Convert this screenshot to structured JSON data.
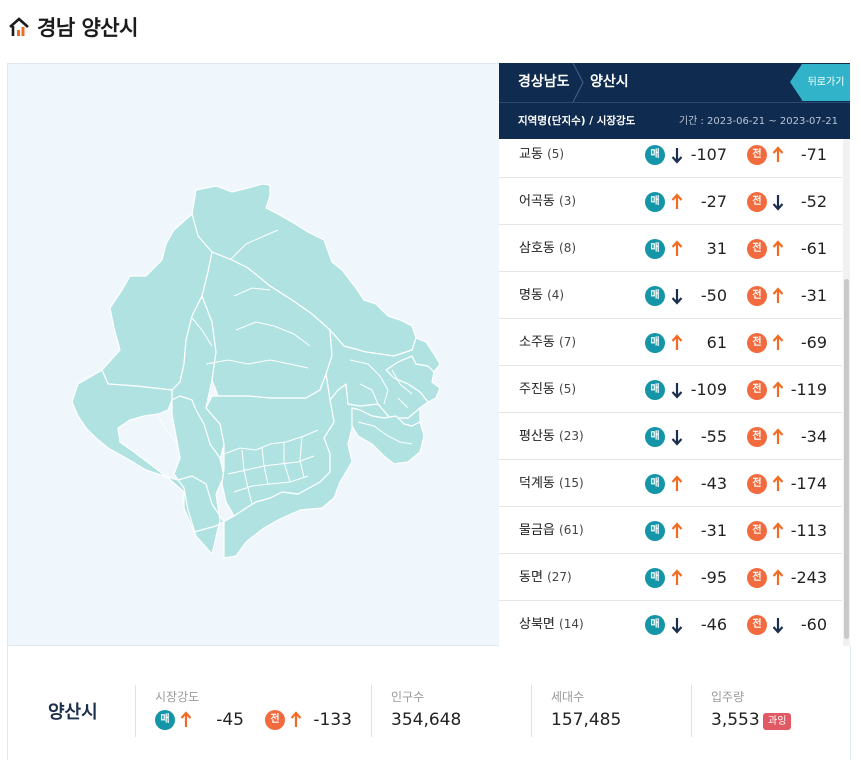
{
  "page": {
    "title": "경남 양산시"
  },
  "panel": {
    "breadcrumb": [
      "경상남도",
      "양산시"
    ],
    "back_label": "뒤로가기",
    "sub_left": "지역명(단지수) / 시장강도",
    "sub_right": "기간 : 2023-06-21 ~ 2023-07-21"
  },
  "badges": {
    "maemae": "매",
    "jeonse": "전"
  },
  "colors": {
    "up": "#f26b22",
    "down": "#1c2f4f",
    "maemae": "#1595a8",
    "jeonse": "#f26b3f",
    "map_fill": "#b0e2e2"
  },
  "rows": [
    {
      "name": "교동",
      "count": "(5)",
      "maemae_dir": "down",
      "maemae": "-107",
      "jeonse_dir": "up",
      "jeonse": "-71"
    },
    {
      "name": "어곡동",
      "count": "(3)",
      "maemae_dir": "up",
      "maemae": "-27",
      "jeonse_dir": "down",
      "jeonse": "-52"
    },
    {
      "name": "삼호동",
      "count": "(8)",
      "maemae_dir": "up",
      "maemae": "31",
      "jeonse_dir": "up",
      "jeonse": "-61"
    },
    {
      "name": "명동",
      "count": "(4)",
      "maemae_dir": "down",
      "maemae": "-50",
      "jeonse_dir": "up",
      "jeonse": "-31"
    },
    {
      "name": "소주동",
      "count": "(7)",
      "maemae_dir": "up",
      "maemae": "61",
      "jeonse_dir": "up",
      "jeonse": "-69"
    },
    {
      "name": "주진동",
      "count": "(5)",
      "maemae_dir": "down",
      "maemae": "-109",
      "jeonse_dir": "up",
      "jeonse": "-119"
    },
    {
      "name": "평산동",
      "count": "(23)",
      "maemae_dir": "down",
      "maemae": "-55",
      "jeonse_dir": "up",
      "jeonse": "-34"
    },
    {
      "name": "덕계동",
      "count": "(15)",
      "maemae_dir": "up",
      "maemae": "-43",
      "jeonse_dir": "up",
      "jeonse": "-174"
    },
    {
      "name": "물금읍",
      "count": "(61)",
      "maemae_dir": "up",
      "maemae": "-31",
      "jeonse_dir": "up",
      "jeonse": "-113"
    },
    {
      "name": "동면",
      "count": "(27)",
      "maemae_dir": "up",
      "maemae": "-95",
      "jeonse_dir": "up",
      "jeonse": "-243"
    },
    {
      "name": "상북면",
      "count": "(14)",
      "maemae_dir": "down",
      "maemae": "-46",
      "jeonse_dir": "down",
      "jeonse": "-60"
    }
  ],
  "summary": {
    "city": "양산시",
    "strength_label": "시장강도",
    "maemae_dir": "up",
    "maemae": "-45",
    "jeonse_dir": "up",
    "jeonse": "-133",
    "population_label": "인구수",
    "population": "354,648",
    "households_label": "세대수",
    "households": "157,485",
    "supply_label": "입주량",
    "supply": "3,553",
    "supply_badge": "과잉"
  }
}
